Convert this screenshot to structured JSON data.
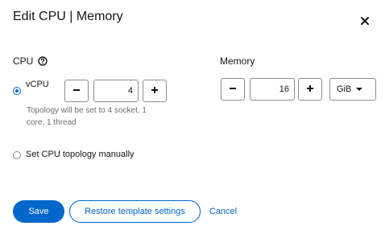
{
  "modal": {
    "title": "Edit CPU | Memory"
  },
  "cpu": {
    "label": "CPU",
    "vcpu_label": "vCPU",
    "vcpu_value": "4",
    "helper_text": "Topology will be set to 4 socket, 1 core, 1 thread",
    "manual_option_label": "Set CPU topology manually",
    "selected_option": "vCPU"
  },
  "memory": {
    "label": "Memory",
    "value": "16",
    "unit": "GiB"
  },
  "footer": {
    "save_label": "Save",
    "restore_label": "Restore template settings",
    "cancel_label": "Cancel"
  },
  "colors": {
    "primary": "#0066cc",
    "border": "#8a8d90",
    "helper_text": "#6a6e73"
  }
}
